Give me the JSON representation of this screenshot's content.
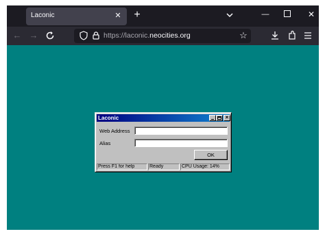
{
  "browser": {
    "tab": {
      "title": "Laconic",
      "close_icon": "close-icon"
    },
    "new_tab_icon": "plus-icon",
    "tab_list_icon": "chevron-down-icon",
    "window": {
      "minimize_icon": "minimize-icon",
      "maximize_icon": "maximize-icon",
      "close_icon": "close-icon"
    },
    "nav": {
      "back_icon": "arrow-left-icon",
      "forward_icon": "arrow-right-icon",
      "reload_icon": "reload-icon"
    },
    "url": {
      "scheme": "https://",
      "subdomain": "laconic.",
      "host": "neocities.org"
    },
    "toolbar_icons": [
      "shield-icon",
      "lock-icon",
      "star-icon",
      "download-icon",
      "extensions-icon",
      "menu-icon"
    ],
    "viewport_bg": "#008080"
  },
  "dialog": {
    "title": "Laconic",
    "web_address_label": "Web Address",
    "web_address_value": "",
    "alias_label": "Alias",
    "alias_value": "",
    "ok_label": "OK",
    "status": {
      "help": "Press F1 for help",
      "state": "Ready",
      "cpu": "CPU Usage: 14%"
    }
  }
}
